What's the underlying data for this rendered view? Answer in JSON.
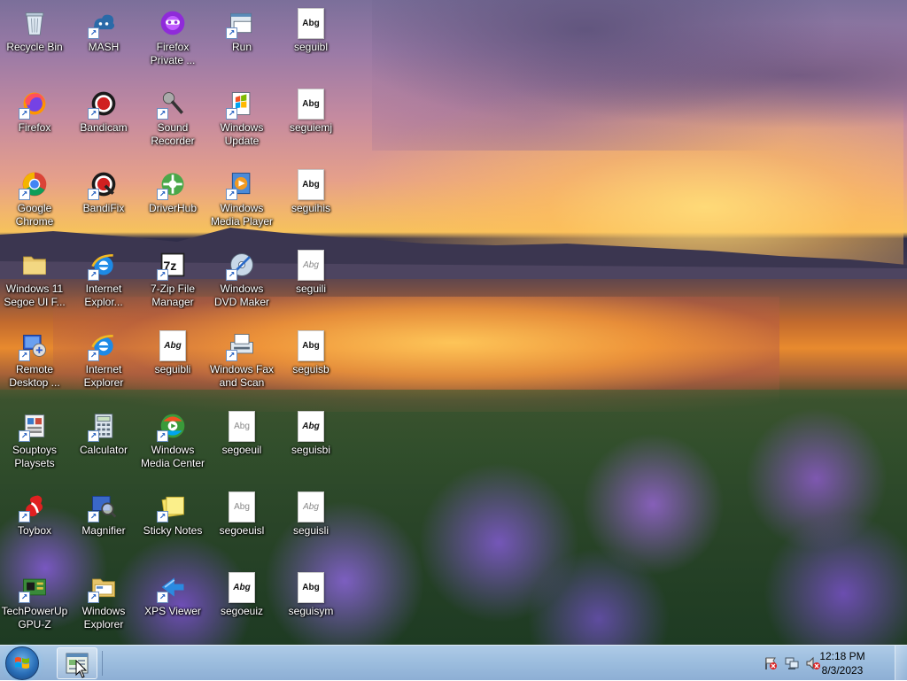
{
  "desktop": {
    "icons": [
      {
        "id": "recycle-bin",
        "label": "Recycle Bin",
        "icon": "recycle-bin-icon"
      },
      {
        "id": "firefox",
        "label": "Firefox",
        "icon": "firefox-icon"
      },
      {
        "id": "google-chrome",
        "label": "Google\nChrome",
        "icon": "chrome-icon"
      },
      {
        "id": "windows11-segoe",
        "label": "Windows 11\nSegoe UI F...",
        "icon": "folder-icon"
      },
      {
        "id": "remote-desktop",
        "label": "Remote\nDesktop ...",
        "icon": "remote-desktop-icon"
      },
      {
        "id": "souptoys",
        "label": "Souptoys\nPlaysets",
        "icon": "souptoys-icon"
      },
      {
        "id": "toybox",
        "label": "Toybox",
        "icon": "toybox-icon"
      },
      {
        "id": "techpowerup-gpuz",
        "label": "TechPowerUp\nGPU-Z",
        "icon": "gpuz-icon"
      },
      {
        "id": "mash",
        "label": "MASH",
        "icon": "mash-icon"
      },
      {
        "id": "bandicam",
        "label": "Bandicam",
        "icon": "bandicam-icon"
      },
      {
        "id": "bandifix",
        "label": "BandiFix",
        "icon": "bandifix-icon"
      },
      {
        "id": "ie-explorer",
        "label": "Internet\nExplor...",
        "icon": "internet-explorer-icon"
      },
      {
        "id": "internet-explorer",
        "label": "Internet\nExplorer",
        "icon": "internet-explorer-icon"
      },
      {
        "id": "calculator",
        "label": "Calculator",
        "icon": "calculator-icon"
      },
      {
        "id": "magnifier",
        "label": "Magnifier",
        "icon": "magnifier-icon"
      },
      {
        "id": "windows-explorer",
        "label": "Windows\nExplorer",
        "icon": "windows-explorer-icon"
      },
      {
        "id": "firefox-private",
        "label": "Firefox\nPrivate ...",
        "icon": "firefox-private-icon"
      },
      {
        "id": "sound-recorder",
        "label": "Sound\nRecorder",
        "icon": "microphone-icon"
      },
      {
        "id": "driverhub",
        "label": "DriverHub",
        "icon": "driverhub-icon"
      },
      {
        "id": "7zip",
        "label": "7-Zip File\nManager",
        "icon": "7zip-icon"
      },
      {
        "id": "seguibli-2",
        "label": "seguibli",
        "icon": "font-file-icon"
      },
      {
        "id": "windows-media-center",
        "label": "Windows\nMedia Center",
        "icon": "media-center-icon"
      },
      {
        "id": "sticky-notes",
        "label": "Sticky Notes",
        "icon": "sticky-notes-icon"
      },
      {
        "id": "xps-viewer",
        "label": "XPS Viewer",
        "icon": "xps-viewer-icon"
      },
      {
        "id": "run",
        "label": "Run",
        "icon": "run-icon"
      },
      {
        "id": "windows-update",
        "label": "Windows\nUpdate",
        "icon": "windows-update-icon"
      },
      {
        "id": "windows-media-player",
        "label": "Windows\nMedia Player",
        "icon": "media-player-icon"
      },
      {
        "id": "windows-dvd-maker",
        "label": "Windows\nDVD Maker",
        "icon": "dvd-maker-icon"
      },
      {
        "id": "windows-fax-scan",
        "label": "Windows Fax\nand Scan",
        "icon": "fax-scan-icon"
      },
      {
        "id": "segoeuil",
        "label": "segoeuil",
        "icon": "font-file-icon"
      },
      {
        "id": "segoeuisl",
        "label": "segoeuisl",
        "icon": "font-file-icon"
      },
      {
        "id": "segoeuiz",
        "label": "segoeuiz",
        "icon": "font-file-icon"
      },
      {
        "id": "seguibl",
        "label": "seguibl",
        "icon": "font-file-icon"
      },
      {
        "id": "seguiemj",
        "label": "seguiemj",
        "icon": "font-file-icon"
      },
      {
        "id": "seguihis",
        "label": "seguihis",
        "icon": "font-file-icon"
      },
      {
        "id": "seguili",
        "label": "seguili",
        "icon": "font-file-icon"
      },
      {
        "id": "seguisb",
        "label": "seguisb",
        "icon": "font-file-icon"
      },
      {
        "id": "seguisbi",
        "label": "seguisbi",
        "icon": "font-file-icon"
      },
      {
        "id": "seguisli",
        "label": "seguisli",
        "icon": "font-file-icon"
      },
      {
        "id": "seguisym",
        "label": "seguisym",
        "icon": "font-file-icon"
      }
    ],
    "font_preview_text": "Abg"
  },
  "taskbar": {
    "start_icon": "windows-start-icon",
    "pinned_app_icon": "control-panel-window-icon",
    "tray_icons": [
      "action-center-flag-icon",
      "network-icon",
      "volume-muted-icon"
    ],
    "clock_time": "12:18 PM",
    "clock_date": "8/3/2023"
  },
  "colors": {
    "taskbar": "#96b9dc",
    "start_orb": "#2a6fb8",
    "label_text": "#ffffff"
  }
}
